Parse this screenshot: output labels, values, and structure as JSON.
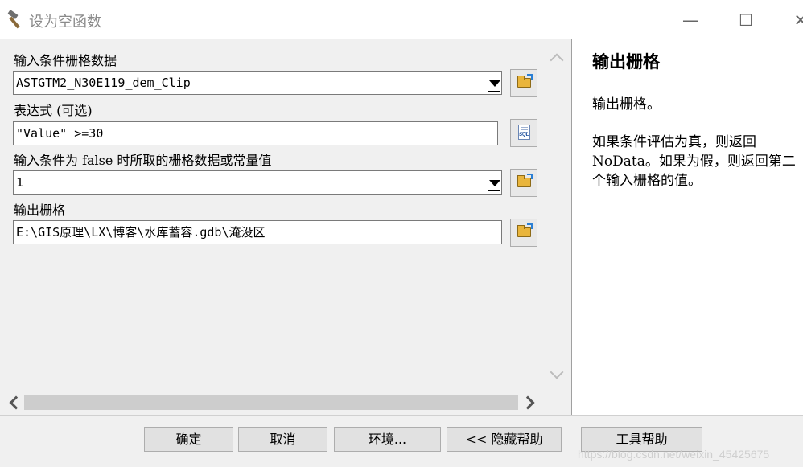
{
  "window": {
    "title": "设为空函数",
    "minimize_glyph": "—",
    "maximize_glyph": "☐",
    "close_glyph": "✕"
  },
  "form": {
    "fields": [
      {
        "label": "输入条件栅格数据",
        "value": "ASTGTM2_N30E119_dem_Clip",
        "control": "dropdown",
        "button_icon": "folder-icon"
      },
      {
        "label": "表达式 (可选)",
        "value": "\"Value\" >=30",
        "control": "text",
        "button_icon": "sql-icon"
      },
      {
        "label": "输入条件为 false 时所取的栅格数据或常量值",
        "value": "1",
        "control": "dropdown",
        "button_icon": "folder-icon"
      },
      {
        "label": "输出栅格",
        "value": "E:\\GIS原理\\LX\\博客\\水库蓄容.gdb\\淹没区",
        "control": "text",
        "button_icon": "folder-icon"
      }
    ],
    "sql_icon_text": "SQL"
  },
  "help": {
    "title": "输出栅格",
    "paragraph1": "输出栅格。",
    "paragraph2": "如果条件评估为真，则返回 NoData。如果为假，则返回第二个输入栅格的值。"
  },
  "footer": {
    "ok_label": "确定",
    "cancel_label": "取消",
    "env_label": "环境...",
    "hide_help_label": "<< 隐藏帮助",
    "tool_help_label": "工具帮助"
  },
  "watermark": "https://blog.csdn.net/weixin_45425675",
  "colors": {
    "folder": "#e9b53c",
    "folder_arrow": "#2a7fd4",
    "panel_bg": "#f0f0f0",
    "help_bg": "#ffffff"
  }
}
